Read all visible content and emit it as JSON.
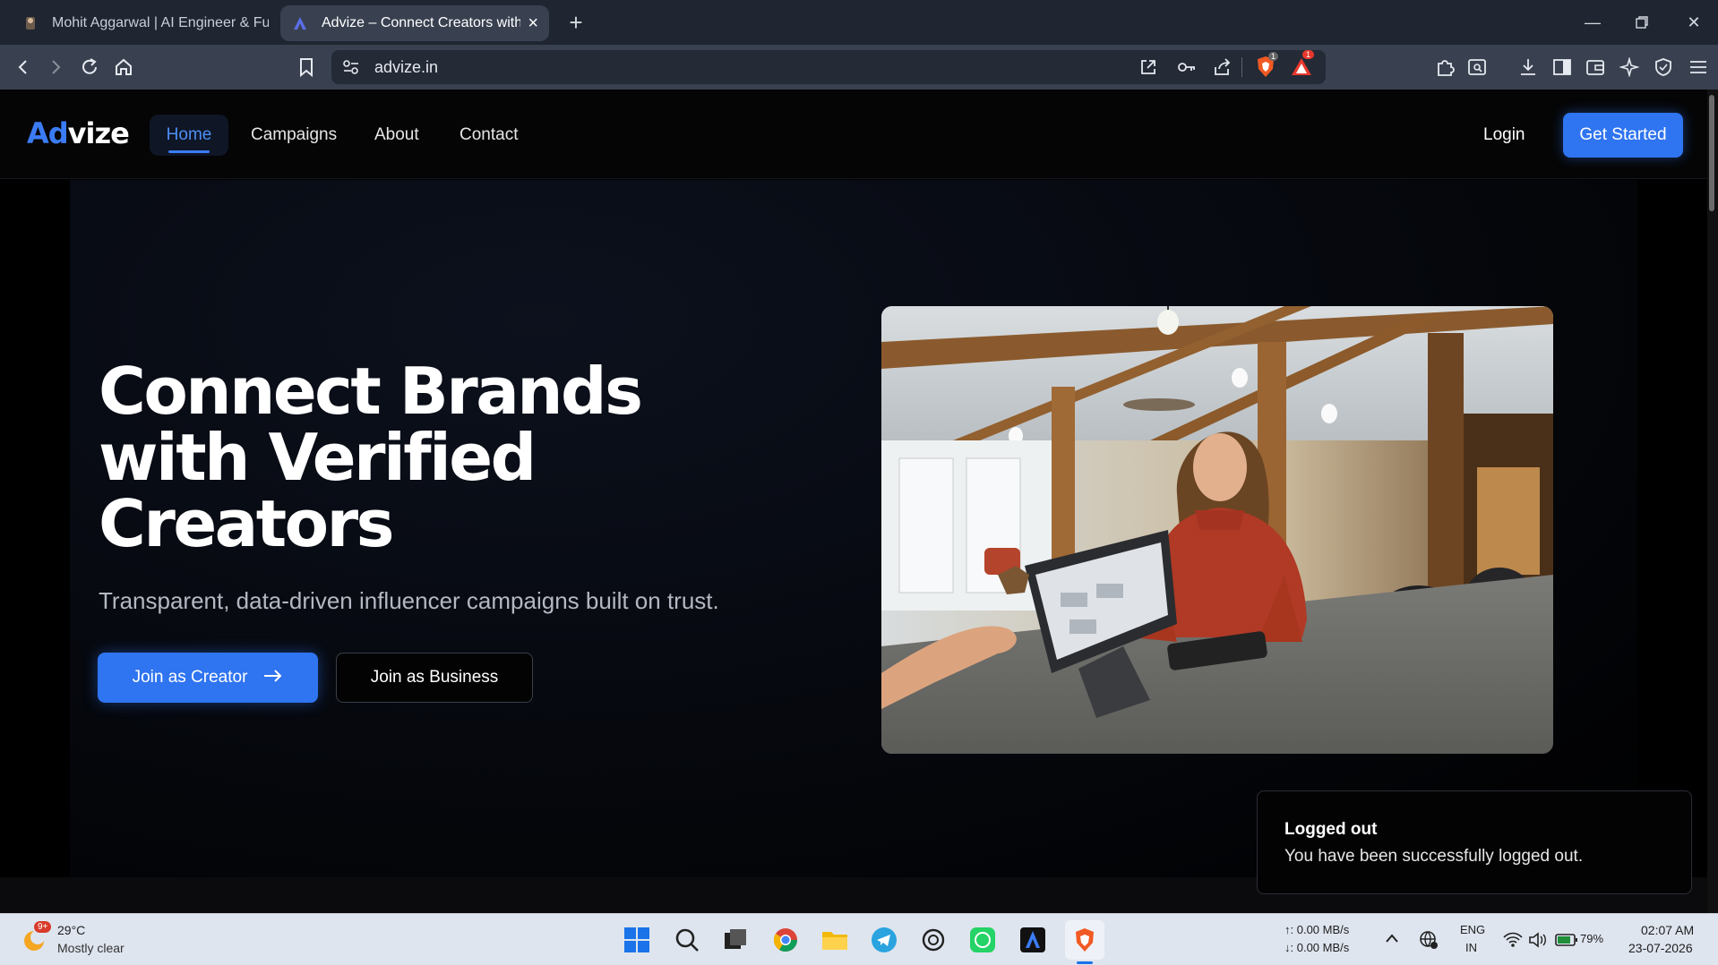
{
  "browser": {
    "tabs": [
      {
        "title": "Mohit Aggarwal | AI Engineer & Full S",
        "active": false
      },
      {
        "title": "Advize – Connect Creators with B",
        "active": true
      }
    ],
    "url": "advize.in",
    "shield_badge": "1",
    "alert_badge": "1"
  },
  "site": {
    "logo_prefix": "Ad",
    "logo_suffix": "vize",
    "nav": {
      "home": "Home",
      "campaigns": "Campaigns",
      "about": "About",
      "contact": "Contact",
      "login": "Login",
      "cta": "Get Started"
    },
    "hero": {
      "title": "Connect Brands with Verified Creators",
      "subtitle": "Transparent, data-driven influencer campaigns built on trust.",
      "btn_creator": "Join as Creator",
      "btn_business": "Join as Business"
    },
    "toast": {
      "title": "Logged out",
      "message": "You have been successfully logged out."
    }
  },
  "taskbar": {
    "weather_temp": "29°C",
    "weather_desc": "Mostly clear",
    "weather_badge": "9+",
    "net_up": "↑: 0.00 MB/s",
    "net_down": "↓: 0.00 MB/s",
    "lang": "ENG",
    "region": "IN",
    "battery": "79%",
    "time": "02:07 AM",
    "date": "23-07-2026"
  },
  "colors": {
    "accent": "#2f74f0",
    "chrome_bg": "#1f2531",
    "toolbar_bg": "#394150"
  }
}
